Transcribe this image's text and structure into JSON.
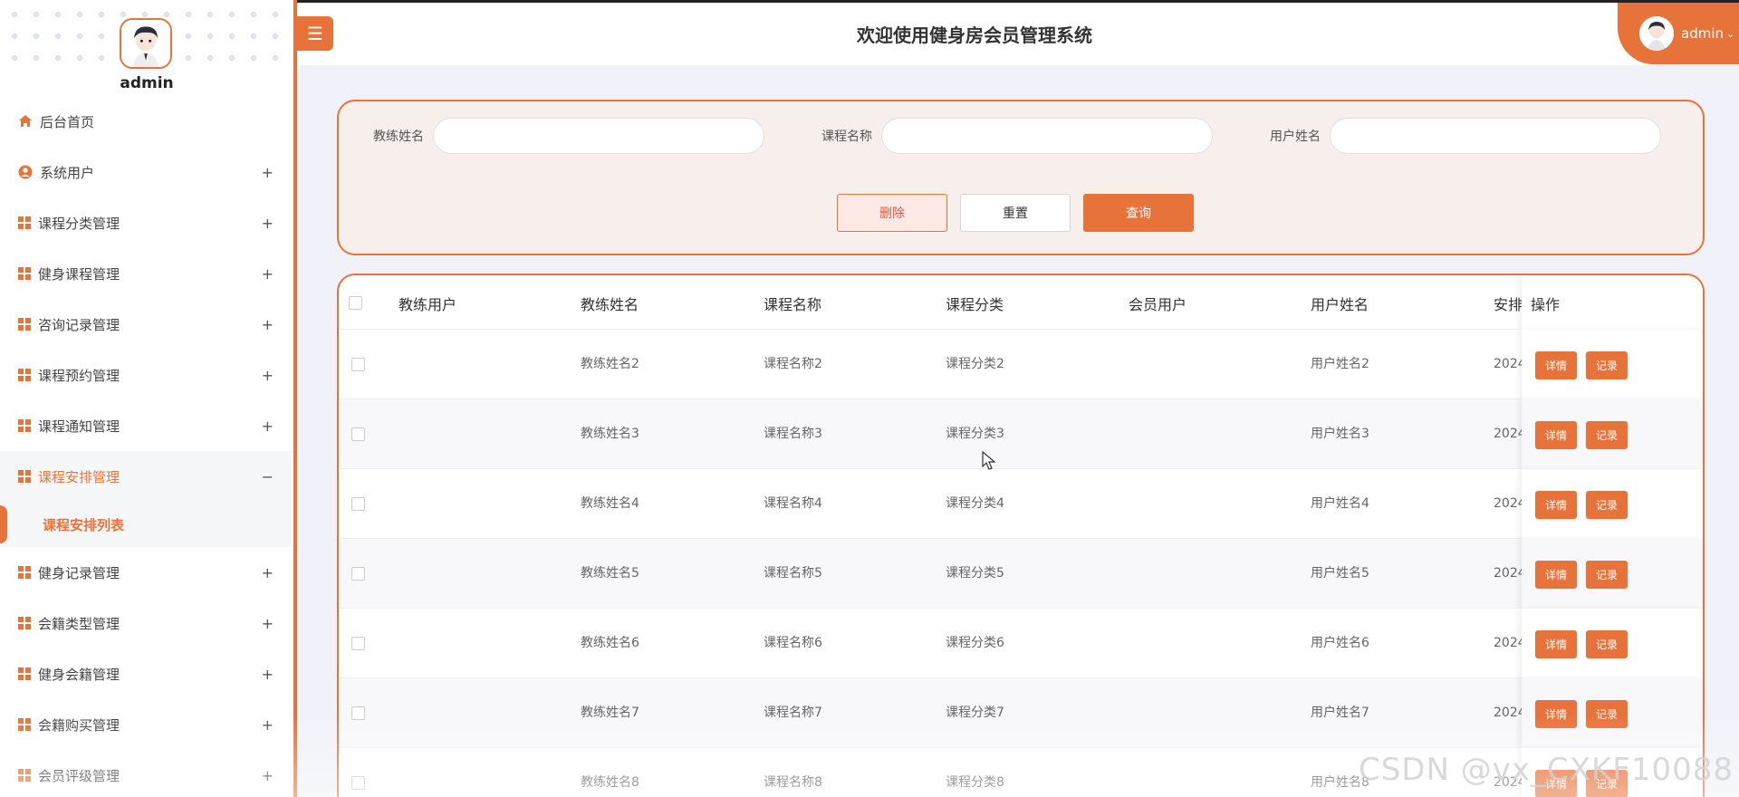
{
  "profile": {
    "name": "admin"
  },
  "sidebar": {
    "items": [
      {
        "label": "后台首页",
        "toggle": "",
        "icon": "home-icon"
      },
      {
        "label": "系统用户",
        "toggle": "+",
        "icon": "user-icon"
      },
      {
        "label": "课程分类管理",
        "toggle": "+",
        "icon": "grid-icon"
      },
      {
        "label": "健身课程管理",
        "toggle": "+",
        "icon": "grid-icon"
      },
      {
        "label": "咨询记录管理",
        "toggle": "+",
        "icon": "grid-icon"
      },
      {
        "label": "课程预约管理",
        "toggle": "+",
        "icon": "grid-icon"
      },
      {
        "label": "课程通知管理",
        "toggle": "+",
        "icon": "grid-icon"
      },
      {
        "label": "课程安排管理",
        "toggle": "−",
        "icon": "grid-icon"
      },
      {
        "label": "健身记录管理",
        "toggle": "+",
        "icon": "grid-icon"
      },
      {
        "label": "会籍类型管理",
        "toggle": "+",
        "icon": "grid-icon"
      },
      {
        "label": "健身会籍管理",
        "toggle": "+",
        "icon": "grid-icon"
      },
      {
        "label": "会籍购买管理",
        "toggle": "+",
        "icon": "grid-icon"
      },
      {
        "label": "会员评级管理",
        "toggle": "+",
        "icon": "grid-icon"
      }
    ],
    "active_sub": "课程安排列表"
  },
  "header": {
    "menu_icon": "☰",
    "title": "欢迎使用健身房会员管理系统",
    "user": "admin",
    "caret": "⌄"
  },
  "search": {
    "coach_name_label": "教练姓名",
    "course_name_label": "课程名称",
    "user_name_label": "用户姓名",
    "delete_label": "删除",
    "reset_label": "重置",
    "query_label": "查询"
  },
  "table": {
    "columns": [
      "教练用户",
      "教练姓名",
      "课程名称",
      "课程分类",
      "会员用户",
      "用户姓名",
      "安排"
    ],
    "ops_header": "操作",
    "detail_label": "详情",
    "record_label": "记录",
    "rows": [
      {
        "coach_user": "",
        "coach_name": "教练姓名2",
        "course_name": "课程名称2",
        "category": "课程分类2",
        "member_user": "",
        "user_name": "用户姓名2",
        "schedule": "2024"
      },
      {
        "coach_user": "",
        "coach_name": "教练姓名3",
        "course_name": "课程名称3",
        "category": "课程分类3",
        "member_user": "",
        "user_name": "用户姓名3",
        "schedule": "2024"
      },
      {
        "coach_user": "",
        "coach_name": "教练姓名4",
        "course_name": "课程名称4",
        "category": "课程分类4",
        "member_user": "",
        "user_name": "用户姓名4",
        "schedule": "2024"
      },
      {
        "coach_user": "",
        "coach_name": "教练姓名5",
        "course_name": "课程名称5",
        "category": "课程分类5",
        "member_user": "",
        "user_name": "用户姓名5",
        "schedule": "2024"
      },
      {
        "coach_user": "",
        "coach_name": "教练姓名6",
        "course_name": "课程名称6",
        "category": "课程分类6",
        "member_user": "",
        "user_name": "用户姓名6",
        "schedule": "2024"
      },
      {
        "coach_user": "",
        "coach_name": "教练姓名7",
        "course_name": "课程名称7",
        "category": "课程分类7",
        "member_user": "",
        "user_name": "用户姓名7",
        "schedule": "2024"
      },
      {
        "coach_user": "",
        "coach_name": "教练姓名8",
        "course_name": "课程名称8",
        "category": "课程分类8",
        "member_user": "",
        "user_name": "用户姓名8",
        "schedule": "2024"
      }
    ]
  },
  "watermark": "CSDN @vx_CXKF10088",
  "colors": {
    "accent": "#e8733a",
    "panel_bg": "#f7efeb",
    "page_bg": "#f1f2f9"
  }
}
